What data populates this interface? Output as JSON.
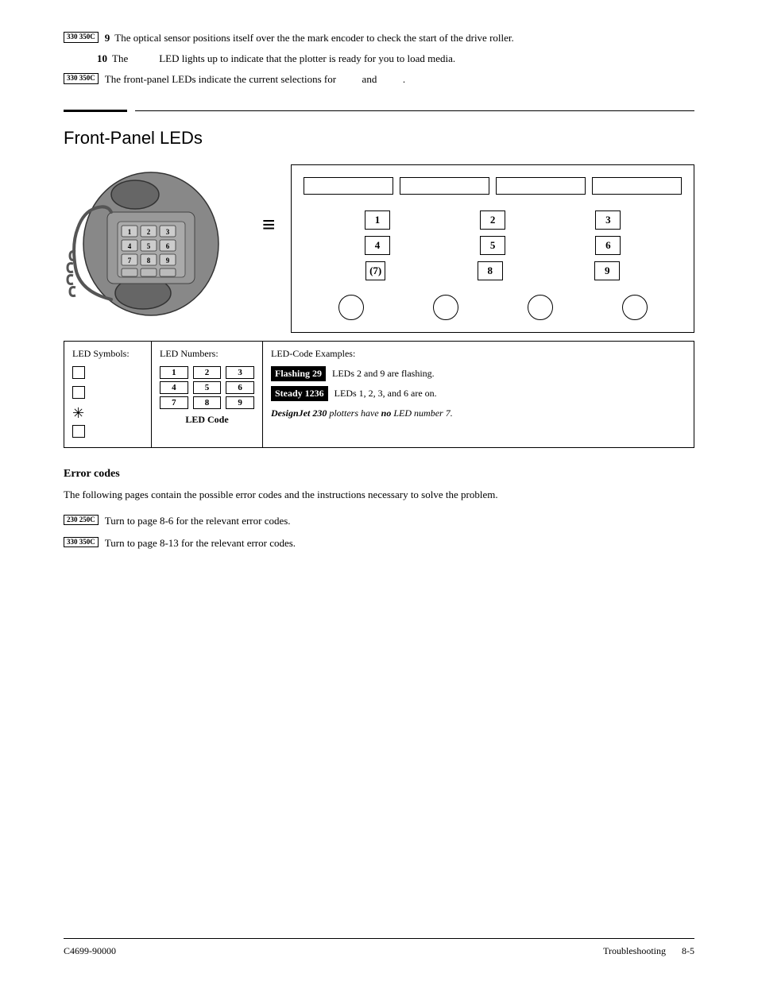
{
  "page": {
    "model_tags": {
      "tag_330_350": "330\n350C",
      "tag_230_250": "230\n250C"
    },
    "steps": [
      {
        "number": "9",
        "model": "330\n350C",
        "text": "The optical sensor positions itself over the the mark encoder to check the start of the drive roller."
      },
      {
        "number": "10",
        "text": "The             LED lights up to indicate that the plotter is ready for you to load media."
      },
      {
        "model": "330\n350C",
        "text": "The front-panel LEDs indicate the current selections for          and          ."
      }
    ],
    "section": {
      "title": "Front-Panel LEDs"
    },
    "led_panel": {
      "top_rects": 4,
      "rows": [
        [
          "1",
          "2",
          "3"
        ],
        [
          "4",
          "5",
          "6"
        ],
        [
          "7",
          "8",
          "9"
        ]
      ],
      "circles": 4
    },
    "led_table": {
      "col_symbols_header": "LED Symbols:",
      "col_numbers_header": "LED Numbers:",
      "col_examples_header": "LED-Code Examples:",
      "numbers": [
        [
          "1",
          "2",
          "3"
        ],
        [
          "4",
          "5",
          "6"
        ],
        [
          "7",
          "8",
          "9"
        ]
      ],
      "led_code_label": "LED Code",
      "examples": [
        {
          "badge": "Flashing 29",
          "text": "LEDs 2 and 9 are flashing."
        },
        {
          "badge": "Steady 1236",
          "text": "LEDs 1, 2, 3, and 6 are on."
        }
      ],
      "note_prefix": "DesignJet 230",
      "note_text": " plotters have ",
      "note_bold": "no",
      "note_suffix": " LED number 7."
    },
    "error_section": {
      "title": "Error codes",
      "description": "The following pages contain the possible error codes and the instructions necessary to solve the problem.",
      "items": [
        {
          "model": "230\n250C",
          "text": "Turn to page 8-6 for the relevant error codes."
        },
        {
          "model": "330\n350C",
          "text": "Turn to page 8-13 for the relevant error codes."
        }
      ]
    },
    "footer": {
      "left": "C4699-90000",
      "right_section": "Troubleshooting",
      "right_page": "8-5"
    }
  }
}
